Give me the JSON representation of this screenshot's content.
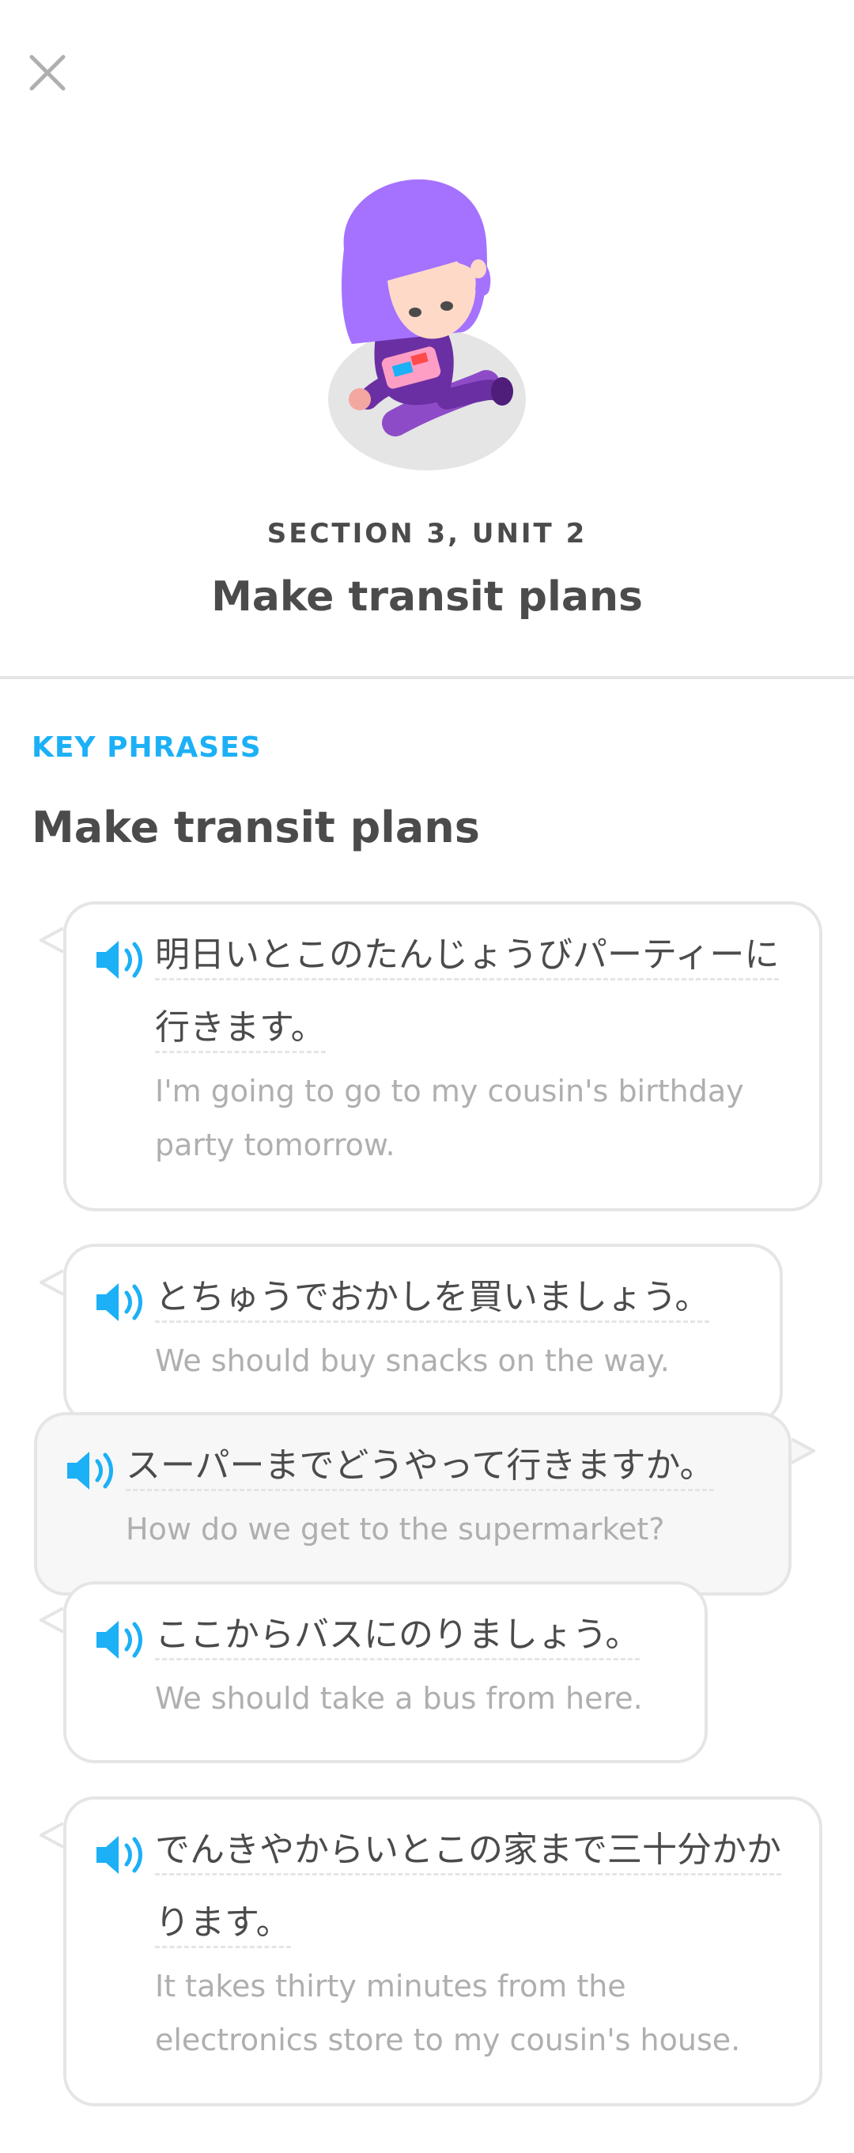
{
  "header": {
    "close_icon": "close-icon",
    "section_label": "SECTION 3, UNIT 2",
    "unit_title": "Make transit plans"
  },
  "key_phrases": {
    "label": "KEY PHRASES",
    "title": "Make transit plans",
    "accent_color": "#1cb0f6",
    "speaker_icon": "speaker-icon",
    "phrases": [
      {
        "japanese": "明日いとこのたんじょうびパーティーに行きます。",
        "english": "I'm going to go to my cousin's birthday party tomorrow."
      },
      {
        "japanese": "とちゅうでおかしを買いましょう。",
        "english": "We should buy snacks on the way."
      },
      {
        "japanese": "スーパーまでどうやって行きますか。",
        "english": "How do we get to the supermarket?"
      },
      {
        "japanese": "ここからバスにのりましょう。",
        "english": "We should take a bus from here."
      },
      {
        "japanese": "でんきやからいとこの家まで三十分かかります。",
        "english": "It takes thirty minutes from the electronics store to my cousin's house."
      }
    ]
  }
}
